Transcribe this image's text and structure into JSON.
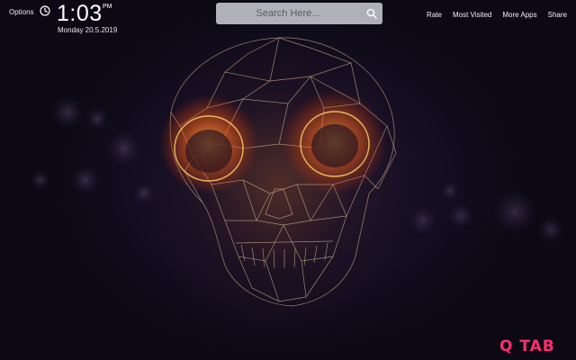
{
  "header": {
    "options_label": "Options",
    "clock": {
      "time": "1:03",
      "period": "PM",
      "date": "Monday  20.5.2019"
    },
    "links": [
      "Rate",
      "Most Visited",
      "More Apps",
      "Share"
    ]
  },
  "search": {
    "placeholder": "Search Here..."
  },
  "brand": {
    "logo_text": "Q TAB",
    "color": "#ff2f6d"
  },
  "icons": {
    "clock": "clock-icon",
    "search": "search-icon"
  }
}
